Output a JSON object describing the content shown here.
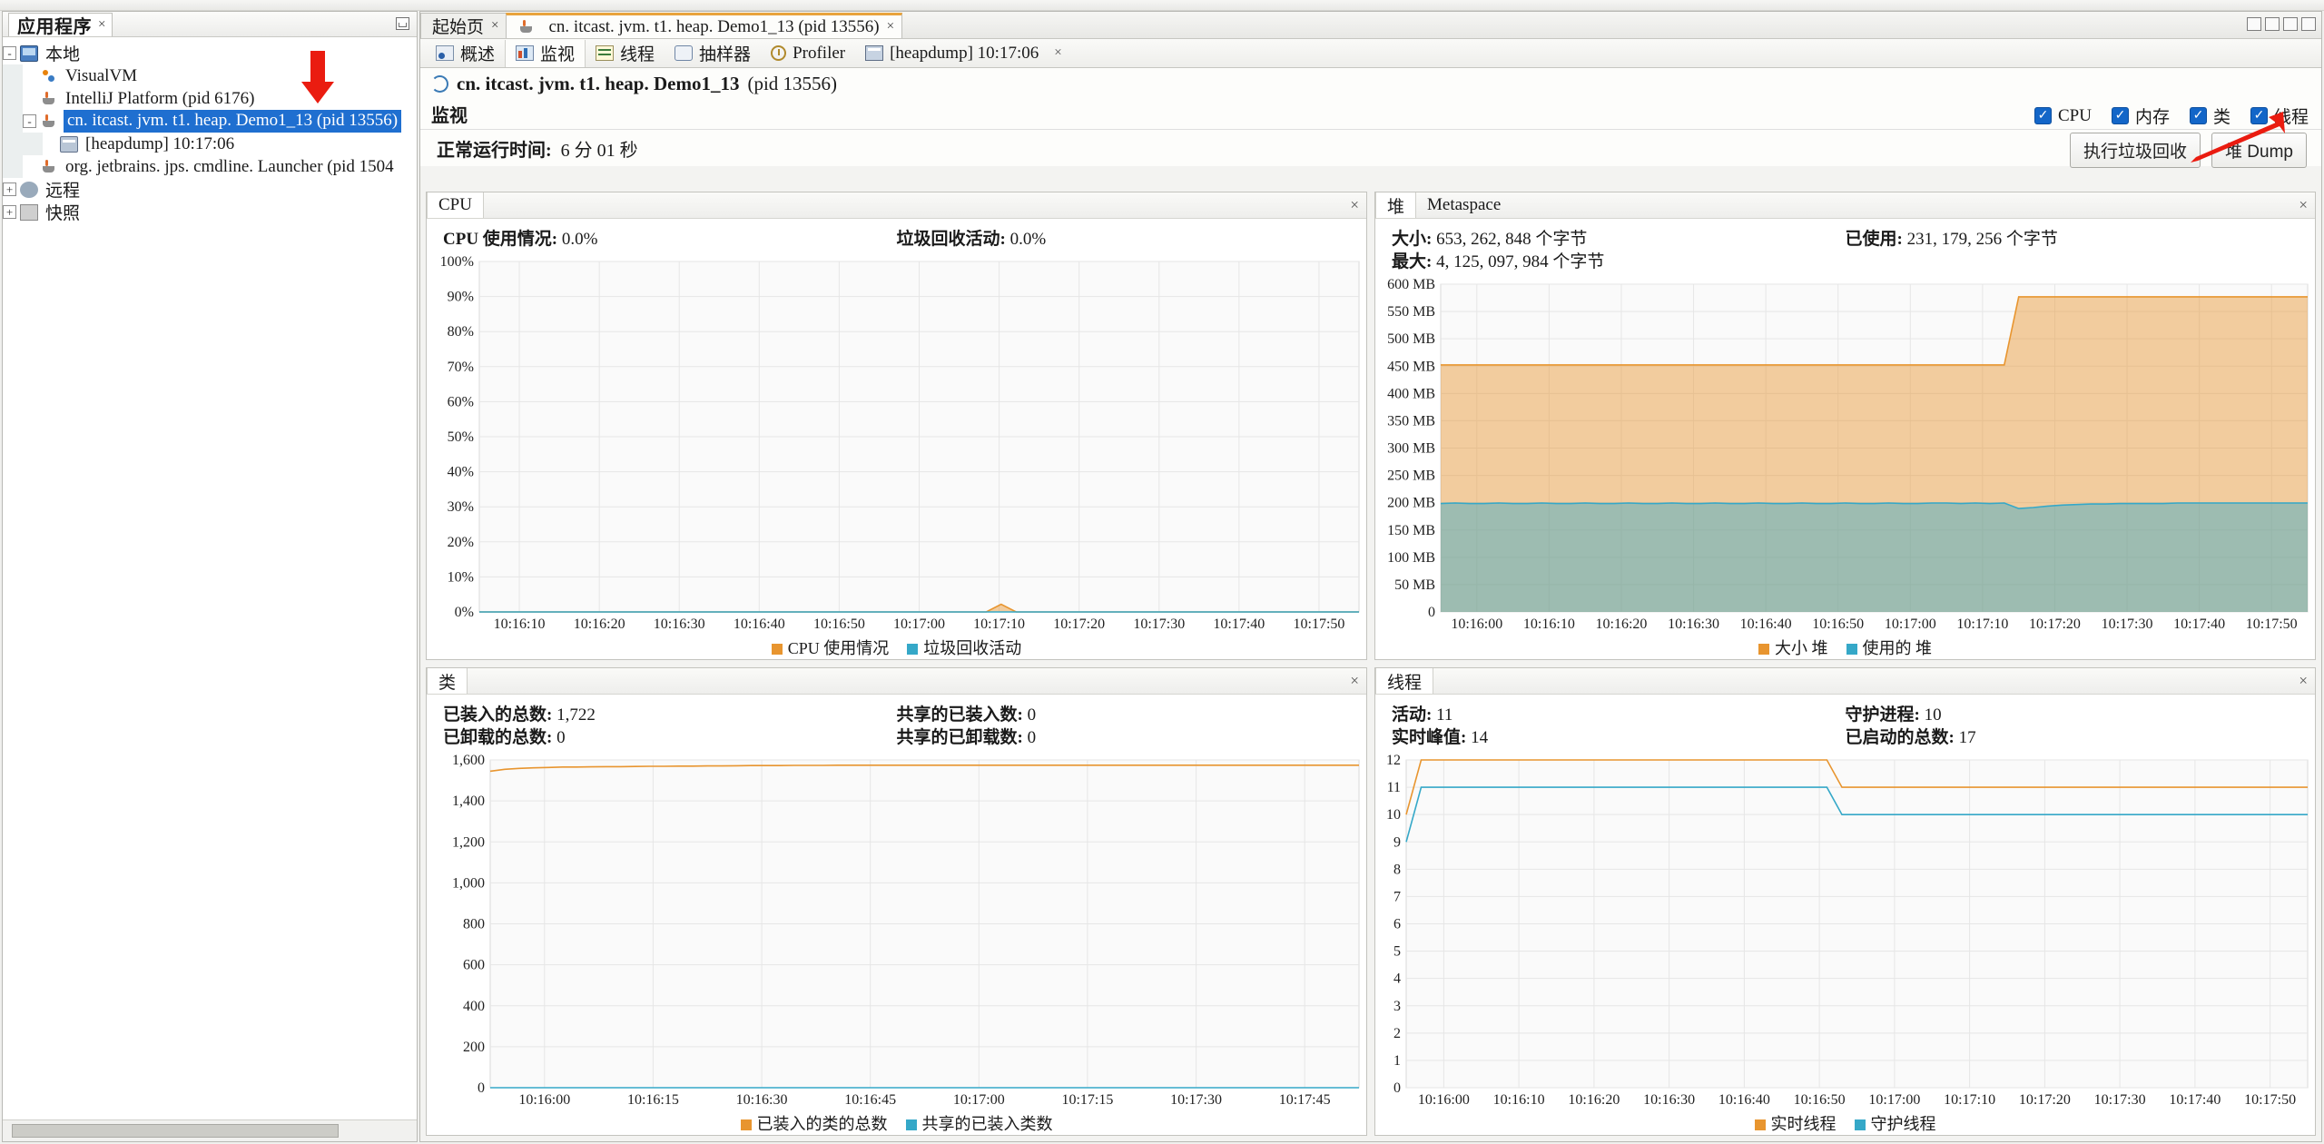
{
  "left_panel": {
    "tab_label": "应用程序",
    "tab_close": "×",
    "tree": [
      {
        "label": "本地",
        "icon": "computer-icon",
        "level": 0,
        "expander": "-"
      },
      {
        "label": "VisualVM",
        "icon": "visualvm-icon",
        "level": 1,
        "expander": ""
      },
      {
        "label": "IntelliJ Platform (pid 6176)",
        "icon": "java-icon",
        "level": 1,
        "expander": ""
      },
      {
        "label": "cn. itcast. jvm. t1. heap. Demo1_13 (pid 13556)",
        "icon": "java-icon",
        "level": 1,
        "expander": "-",
        "selected": true
      },
      {
        "label": "[heapdump] 10:17:06",
        "icon": "heapdump-icon",
        "level": 2,
        "expander": ""
      },
      {
        "label": "org. jetbrains. jps. cmdline. Launcher (pid 1504",
        "icon": "java-icon",
        "level": 1,
        "expander": ""
      },
      {
        "label": "远程",
        "icon": "remote-icon",
        "level": 0,
        "expander": "+"
      },
      {
        "label": "快照",
        "icon": "snapshot-icon",
        "level": 0,
        "expander": "+"
      }
    ]
  },
  "main": {
    "tabs": [
      {
        "label": "起始页",
        "icon": "start-page-icon",
        "close": "×",
        "active": false
      },
      {
        "label": "cn. itcast. jvm. t1. heap. Demo1_13 (pid 13556)",
        "icon": "java-icon",
        "close": "×",
        "active": true
      }
    ],
    "sub_tabs": [
      {
        "label": "概述",
        "icon": "overview-icon",
        "active": false
      },
      {
        "label": "监视",
        "icon": "monitor-icon",
        "active": true
      },
      {
        "label": "线程",
        "icon": "thread-icon",
        "active": false
      },
      {
        "label": "抽样器",
        "icon": "sampler-icon",
        "active": false
      },
      {
        "label": "Profiler",
        "icon": "profiler-icon",
        "active": false
      },
      {
        "label": "[heapdump] 10:17:06",
        "icon": "heapdump-icon",
        "close": "×",
        "active": false
      }
    ],
    "process_title": "cn. itcast. jvm. t1. heap. Demo1_13",
    "process_pid": "(pid 13556)",
    "monitor_label": "监视",
    "checkboxes": [
      {
        "label": "CPU",
        "checked": true
      },
      {
        "label": "内存",
        "checked": true
      },
      {
        "label": "类",
        "checked": true
      },
      {
        "label": "线程",
        "checked": true
      }
    ],
    "uptime_label": "正常运行时间:",
    "uptime_value": "6 分 01 秒",
    "buttons": [
      {
        "label": "执行垃圾回收"
      },
      {
        "label": "堆 Dump"
      }
    ]
  },
  "cpu_panel": {
    "title": "CPU",
    "close": "×",
    "stat_left_label": "CPU 使用情况:",
    "stat_left_value": "0.0%",
    "stat_right_label": "垃圾回收活动:",
    "stat_right_value": "0.0%",
    "legend": [
      {
        "label": "CPU 使用情况",
        "color": "#e8952f"
      },
      {
        "label": "垃圾回收活动",
        "color": "#35a8c8"
      }
    ]
  },
  "heap_panel": {
    "tabs": [
      {
        "label": "堆",
        "active": true
      },
      {
        "label": "Metaspace",
        "active": false
      }
    ],
    "close": "×",
    "size_label": "大小:",
    "size_value": "653, 262, 848 个字节",
    "max_label": "最大:",
    "max_value": "4, 125, 097, 984 个字节",
    "used_label": "已使用:",
    "used_value": "231, 179, 256 个字节",
    "legend": [
      {
        "label": "大小 堆",
        "color": "#e8952f"
      },
      {
        "label": "使用的 堆",
        "color": "#35a8c8"
      }
    ]
  },
  "classes_panel": {
    "title": "类",
    "close": "×",
    "loaded_total_label": "已装入的总数:",
    "loaded_total_value": "1,722",
    "unloaded_total_label": "已卸载的总数:",
    "unloaded_total_value": "0",
    "shared_loaded_label": "共享的已装入数:",
    "shared_loaded_value": "0",
    "shared_unloaded_label": "共享的已卸载数:",
    "shared_unloaded_value": "0",
    "legend": [
      {
        "label": "已装入的类的总数",
        "color": "#e8952f"
      },
      {
        "label": "共享的已装入类数",
        "color": "#35a8c8"
      }
    ]
  },
  "threads_panel": {
    "title": "线程",
    "close": "×",
    "live_label": "活动:",
    "live_value": "11",
    "peak_label": "实时峰值:",
    "peak_value": "14",
    "daemon_label": "守护进程:",
    "daemon_value": "10",
    "started_label": "已启动的总数:",
    "started_value": "17",
    "legend": [
      {
        "label": "实时线程",
        "color": "#e8952f"
      },
      {
        "label": "守护线程",
        "color": "#35a8c8"
      }
    ]
  },
  "chart_data": [
    {
      "type": "area",
      "name": "cpu",
      "title": "CPU",
      "ylabel": "",
      "xlabel": "",
      "ylim": [
        0,
        100
      ],
      "yticks": [
        "0%",
        "10%",
        "20%",
        "30%",
        "40%",
        "50%",
        "60%",
        "70%",
        "80%",
        "90%",
        "100%"
      ],
      "xticks": [
        "10:16:10",
        "10:16:20",
        "10:16:30",
        "10:16:40",
        "10:16:50",
        "10:17:00",
        "10:17:10",
        "10:17:20",
        "10:17:30",
        "10:17:40",
        "10:17:50"
      ],
      "series": [
        {
          "name": "CPU 使用情况",
          "color": "#e8952f",
          "values": [
            0,
            0,
            0,
            0,
            0,
            0,
            0,
            0,
            0,
            0,
            0,
            0,
            0,
            0,
            0,
            0,
            0,
            0,
            0,
            0,
            0,
            0,
            0,
            0,
            0,
            0,
            0,
            0,
            0,
            0,
            0,
            0,
            0,
            0,
            0,
            2.2,
            0,
            0,
            0,
            0,
            0,
            0,
            0,
            0,
            0,
            0,
            0,
            0,
            0,
            0,
            0,
            0,
            0,
            0,
            0,
            0,
            0,
            0,
            0,
            0
          ]
        },
        {
          "name": "垃圾回收活动",
          "color": "#35a8c8",
          "values": [
            0,
            0,
            0,
            0,
            0,
            0,
            0,
            0,
            0,
            0,
            0,
            0,
            0,
            0,
            0,
            0,
            0,
            0,
            0,
            0,
            0,
            0,
            0,
            0,
            0,
            0,
            0,
            0,
            0,
            0,
            0,
            0,
            0,
            0,
            0,
            0,
            0,
            0,
            0,
            0,
            0,
            0,
            0,
            0,
            0,
            0,
            0,
            0,
            0,
            0,
            0,
            0,
            0,
            0,
            0,
            0,
            0,
            0,
            0,
            0,
            0
          ]
        }
      ]
    },
    {
      "type": "area",
      "name": "heap",
      "title": "堆",
      "ylim": [
        0,
        650
      ],
      "yticks": [
        "0",
        "50 MB",
        "100 MB",
        "150 MB",
        "200 MB",
        "250 MB",
        "300 MB",
        "350 MB",
        "400 MB",
        "450 MB",
        "500 MB",
        "550 MB",
        "600 MB"
      ],
      "xticks": [
        "10:16:00",
        "10:16:10",
        "10:16:20",
        "10:16:30",
        "10:16:40",
        "10:16:50",
        "10:17:00",
        "10:17:10",
        "10:17:20",
        "10:17:30",
        "10:17:40",
        "10:17:50"
      ],
      "series": [
        {
          "name": "大小 堆",
          "color": "#e8952f",
          "values": [
            490,
            490,
            490,
            490,
            490,
            490,
            490,
            490,
            490,
            490,
            490,
            490,
            490,
            490,
            490,
            490,
            490,
            490,
            490,
            490,
            490,
            490,
            490,
            490,
            490,
            490,
            490,
            490,
            490,
            490,
            490,
            490,
            490,
            490,
            490,
            490,
            490,
            490,
            490,
            490,
            625,
            625,
            625,
            625,
            625,
            625,
            625,
            625,
            625,
            625,
            625,
            625,
            625,
            625,
            625,
            625,
            625,
            625,
            625,
            625,
            625
          ]
        },
        {
          "name": "使用的 堆",
          "color": "#35a8c8",
          "values": [
            215,
            216,
            215,
            215,
            216,
            215,
            215,
            216,
            215,
            215,
            216,
            215,
            215,
            216,
            215,
            215,
            216,
            215,
            215,
            216,
            215,
            215,
            216,
            215,
            215,
            216,
            215,
            215,
            216,
            215,
            215,
            216,
            215,
            215,
            216,
            216,
            215,
            216,
            215,
            216,
            205,
            207,
            210,
            212,
            213,
            214,
            214,
            215,
            215,
            215,
            215,
            216,
            216,
            216,
            216,
            216,
            216,
            216,
            216,
            216,
            216
          ]
        }
      ]
    },
    {
      "type": "line",
      "name": "classes",
      "title": "类",
      "ylim": [
        0,
        1750
      ],
      "yticks": [
        "0",
        "200",
        "400",
        "600",
        "800",
        "1,000",
        "1,200",
        "1,400",
        "1,600"
      ],
      "xticks": [
        "10:16:00",
        "10:16:15",
        "10:16:30",
        "10:16:45",
        "10:17:00",
        "10:17:15",
        "10:17:30",
        "10:17:45"
      ],
      "series": [
        {
          "name": "已装入的类的总数",
          "color": "#e8952f",
          "values": [
            1690,
            1700,
            1705,
            1708,
            1710,
            1712,
            1712,
            1713,
            1714,
            1714,
            1715,
            1716,
            1716,
            1717,
            1717,
            1718,
            1718,
            1719,
            1720,
            1720,
            1720,
            1721,
            1721,
            1721,
            1722,
            1722,
            1722,
            1722,
            1722,
            1722,
            1722,
            1722,
            1722,
            1722,
            1722,
            1722,
            1722,
            1722,
            1722,
            1722,
            1722,
            1722,
            1722,
            1722,
            1722,
            1722,
            1722,
            1722,
            1722,
            1722,
            1722,
            1722,
            1722,
            1722,
            1722,
            1722,
            1722,
            1722,
            1722,
            1722,
            1722
          ]
        },
        {
          "name": "共享的已装入类数",
          "color": "#35a8c8",
          "values": [
            0,
            0,
            0,
            0,
            0,
            0,
            0,
            0,
            0,
            0,
            0,
            0,
            0,
            0,
            0,
            0,
            0,
            0,
            0,
            0,
            0,
            0,
            0,
            0,
            0,
            0,
            0,
            0,
            0,
            0,
            0,
            0,
            0,
            0,
            0,
            0,
            0,
            0,
            0,
            0,
            0,
            0,
            0,
            0,
            0,
            0,
            0,
            0,
            0,
            0,
            0,
            0,
            0,
            0,
            0,
            0,
            0,
            0,
            0,
            0,
            0
          ]
        }
      ]
    },
    {
      "type": "line",
      "name": "threads",
      "title": "线程",
      "ylim": [
        0,
        12
      ],
      "yticks": [
        "0",
        "1",
        "2",
        "3",
        "4",
        "5",
        "6",
        "7",
        "8",
        "9",
        "10",
        "11",
        "12"
      ],
      "xticks": [
        "10:16:00",
        "10:16:10",
        "10:16:20",
        "10:16:30",
        "10:16:40",
        "10:16:50",
        "10:17:00",
        "10:17:10",
        "10:17:20",
        "10:17:30",
        "10:17:40",
        "10:17:50"
      ],
      "series": [
        {
          "name": "实时线程",
          "color": "#e8952f",
          "values": [
            10,
            12,
            12,
            12,
            12,
            12,
            12,
            12,
            12,
            12,
            12,
            12,
            12,
            12,
            12,
            12,
            12,
            12,
            12,
            12,
            12,
            12,
            12,
            12,
            12,
            12,
            12,
            12,
            12,
            11,
            11,
            11,
            11,
            11,
            11,
            11,
            11,
            11,
            11,
            11,
            11,
            11,
            11,
            11,
            11,
            11,
            11,
            11,
            11,
            11,
            11,
            11,
            11,
            11,
            11,
            11,
            11,
            11,
            11,
            11,
            11
          ]
        },
        {
          "name": "守护线程",
          "color": "#35a8c8",
          "values": [
            9,
            11,
            11,
            11,
            11,
            11,
            11,
            11,
            11,
            11,
            11,
            11,
            11,
            11,
            11,
            11,
            11,
            11,
            11,
            11,
            11,
            11,
            11,
            11,
            11,
            11,
            11,
            11,
            11,
            10,
            10,
            10,
            10,
            10,
            10,
            10,
            10,
            10,
            10,
            10,
            10,
            10,
            10,
            10,
            10,
            10,
            10,
            10,
            10,
            10,
            10,
            10,
            10,
            10,
            10,
            10,
            10,
            10,
            10,
            10,
            10
          ]
        }
      ]
    }
  ]
}
